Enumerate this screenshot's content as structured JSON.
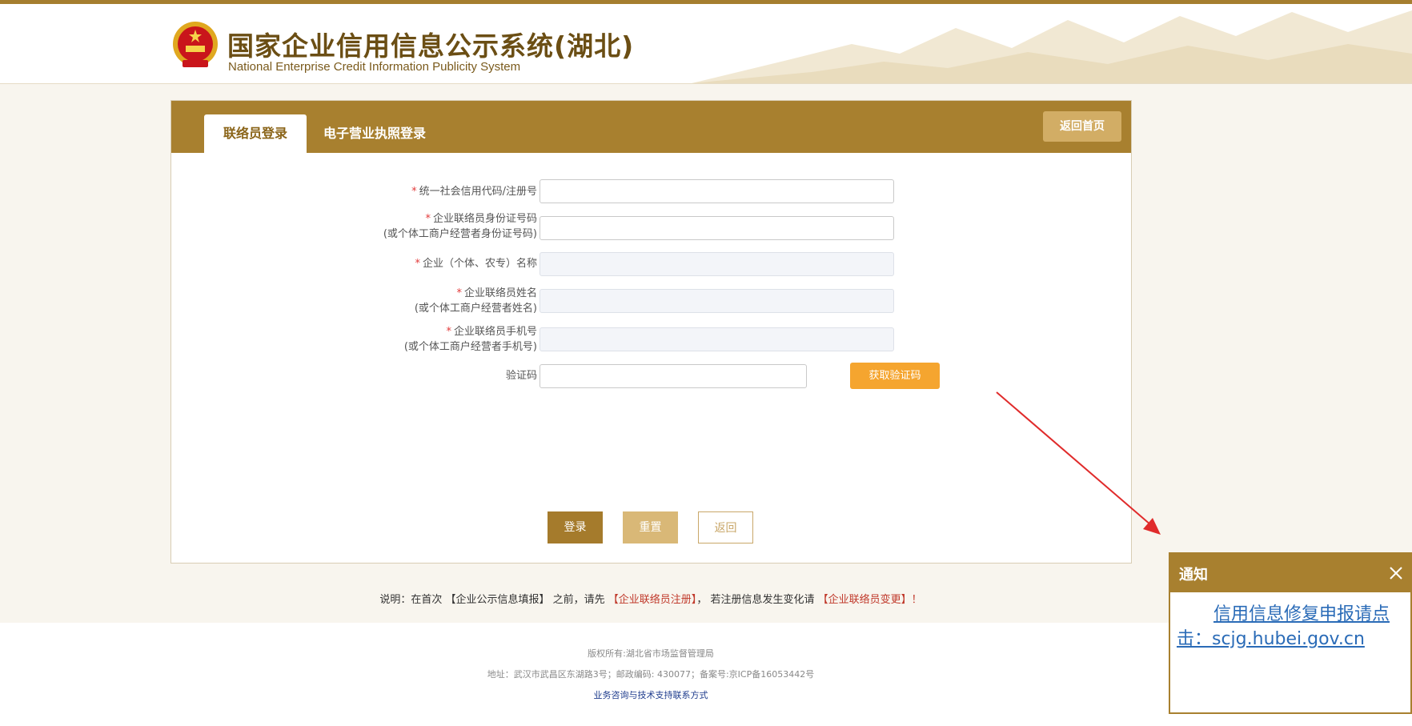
{
  "header": {
    "title": "国家企业信用信息公示系统(湖北)",
    "subtitle": "National Enterprise Credit Information Publicity System"
  },
  "tabs": [
    {
      "label": "联络员登录",
      "active": true
    },
    {
      "label": "电子营业执照登录",
      "active": false
    }
  ],
  "home_button": "返回首页",
  "form": {
    "fields": [
      {
        "required": "*",
        "label": "统一社会信用代码/注册号",
        "label2": "",
        "value": "",
        "disabled": false
      },
      {
        "required": "*",
        "label": "企业联络员身份证号码",
        "label2": "(或个体工商户经营者身份证号码)",
        "value": "",
        "disabled": false
      },
      {
        "required": "*",
        "label": "企业（个体、农专）名称",
        "label2": "",
        "value": "",
        "disabled": true
      },
      {
        "required": "*",
        "label": "企业联络员姓名",
        "label2": "(或个体工商户经营者姓名)",
        "value": "",
        "disabled": true
      },
      {
        "required": "*",
        "label": "企业联络员手机号",
        "label2": "(或个体工商户经营者手机号)",
        "value": "",
        "disabled": true
      }
    ],
    "captcha_label": "验证码",
    "captcha_value": "",
    "get_code_button": "获取验证码",
    "login_button": "登录",
    "reset_button": "重置",
    "back_button": "返回"
  },
  "note": {
    "prefix": "说明：在首次 【企业公示信息填报】 之前，请先 ",
    "link1": "【企业联络员注册】",
    "middle": "， 若注册信息发生变化请 ",
    "link2": "【企业联络员变更】！"
  },
  "footer": {
    "copyright": "版权所有:湖北省市场监督管理局",
    "address": "地址：武汉市武昌区东湖路3号；邮政编码: 430077；备案号:京ICP备16053442号",
    "contact_link": "业务咨询与技术支持联系方式"
  },
  "notice": {
    "title": "通知",
    "body": "信用信息修复申报请点击：scjg.hubei.gov.cn"
  },
  "colors": {
    "brand": "#a8802f",
    "accent_orange": "#f5a52f",
    "required_red": "#e23a3a",
    "link_blue": "#2a6bb7"
  }
}
